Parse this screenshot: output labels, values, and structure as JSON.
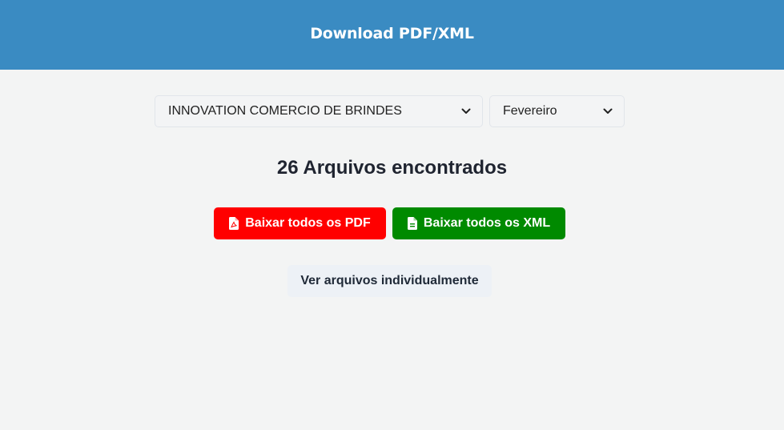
{
  "header": {
    "title": "Download PDF/XML"
  },
  "filters": {
    "company": {
      "selected": "INNOVATION COMERCIO DE BRINDES",
      "icon": "chevron-down-icon"
    },
    "month": {
      "selected": "Fevereiro",
      "icon": "chevron-down-icon"
    }
  },
  "results": {
    "count_title": "26 Arquivos encontrados"
  },
  "actions": {
    "download_pdf": {
      "label": "Baixar todos os PDF",
      "icon": "file-pdf-icon",
      "color": "#ff0000"
    },
    "download_xml": {
      "label": "Baixar todos os XML",
      "icon": "file-text-icon",
      "color": "#008a00"
    },
    "view_individual": {
      "label": "Ver arquivos individualmente"
    }
  },
  "colors": {
    "header_bg": "#3a8bc2",
    "page_bg": "#f3f4f4"
  }
}
